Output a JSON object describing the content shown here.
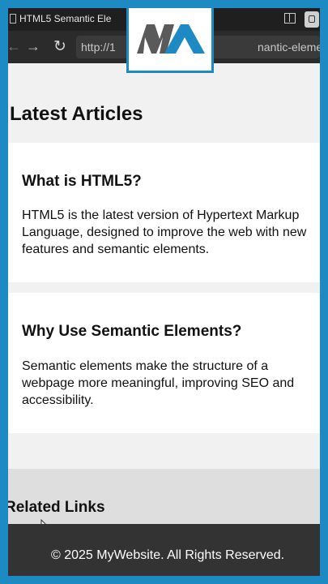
{
  "browser": {
    "tab_title": "HTML5 Semantic Ele",
    "url_prefix": "http://1",
    "url_suffix": "nantic-elements.html"
  },
  "logo": {
    "text": "MA"
  },
  "main": {
    "section_title": "Latest Articles",
    "articles": [
      {
        "title": "What is HTML5?",
        "body": "HTML5 is the latest version of Hypertext Markup Language, designed to improve the web with new features and semantic elements."
      },
      {
        "title": "Why Use Semantic Elements?",
        "body": "Semantic elements make the structure of a webpage more meaningful, improving SEO and accessibility."
      }
    ]
  },
  "aside": {
    "title": "Related Links"
  },
  "footer": {
    "text": "© 2025 MyWebsite. All Rights Reserved."
  },
  "colors": {
    "frame_border": "#1e8ac4",
    "footer_bg": "#333333",
    "page_bg": "#f1f1f1"
  }
}
